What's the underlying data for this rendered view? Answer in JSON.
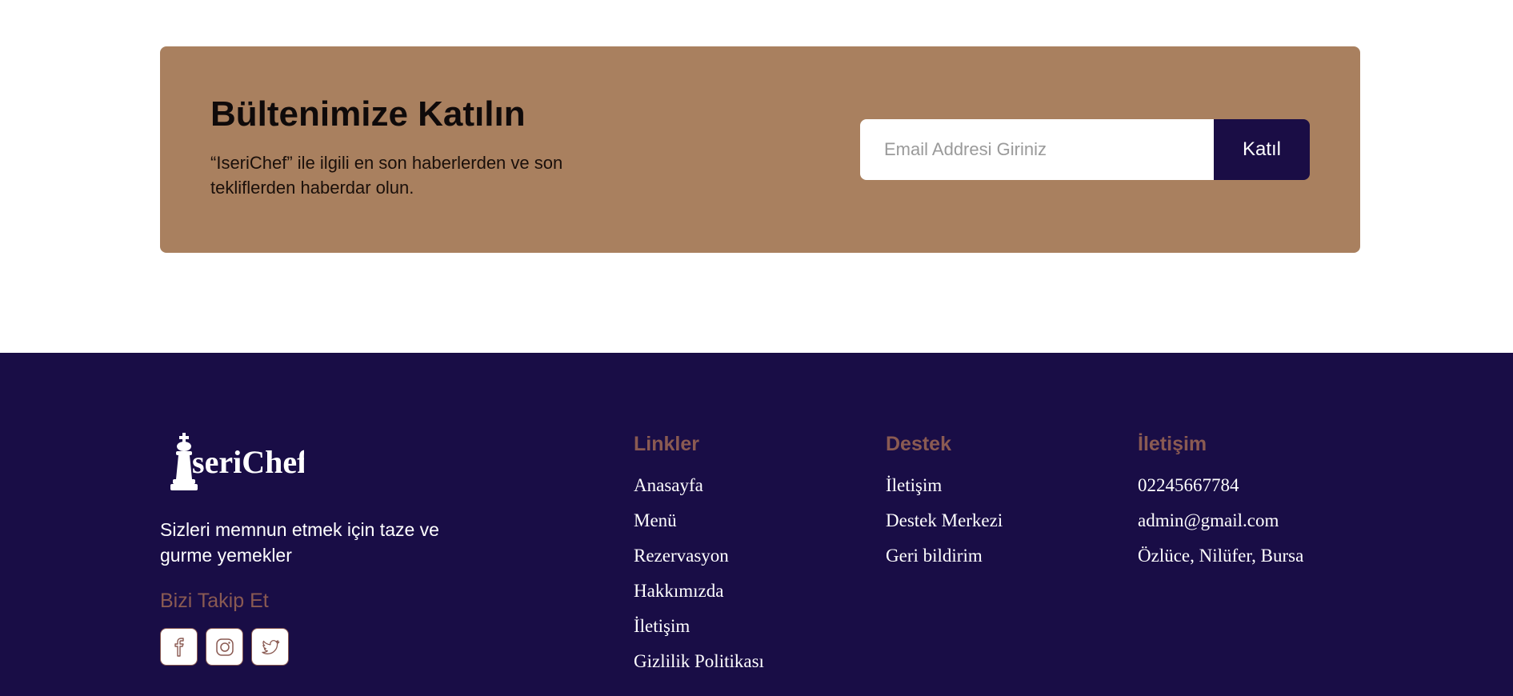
{
  "newsletter": {
    "title": "Bültenimize Katılın",
    "description": "“IseriChef” ile ilgili en son haberlerden ve son tekliflerden haberdar olun.",
    "email_placeholder": "Email Addresi Giriniz",
    "submit_label": "Katıl",
    "background_color": "#a9805f",
    "button_color": "#1a0d45"
  },
  "footer": {
    "background_color": "#190d46",
    "accent_color": "#8a5a52",
    "logo_text": "seriChef",
    "tagline": "Sizleri memnun etmek için taze ve gurme yemekler",
    "follow_title": "Bizi Takip Et",
    "socials": [
      {
        "icon": "facebook-icon"
      },
      {
        "icon": "instagram-icon"
      },
      {
        "icon": "twitter-icon"
      }
    ],
    "links": {
      "title": "Linkler",
      "items": [
        "Anasayfa",
        "Menü",
        "Rezervasyon",
        "Hakkımızda",
        "İletişim",
        "Gizlilik Politikası"
      ]
    },
    "support": {
      "title": "Destek",
      "items": [
        "İletişim",
        "Destek Merkezi",
        "Geri bildirim"
      ]
    },
    "contact": {
      "title": "İletişim",
      "items": [
        "02245667784",
        "admin@gmail.com",
        "Özlüce, Nilüfer, Bursa"
      ]
    }
  }
}
